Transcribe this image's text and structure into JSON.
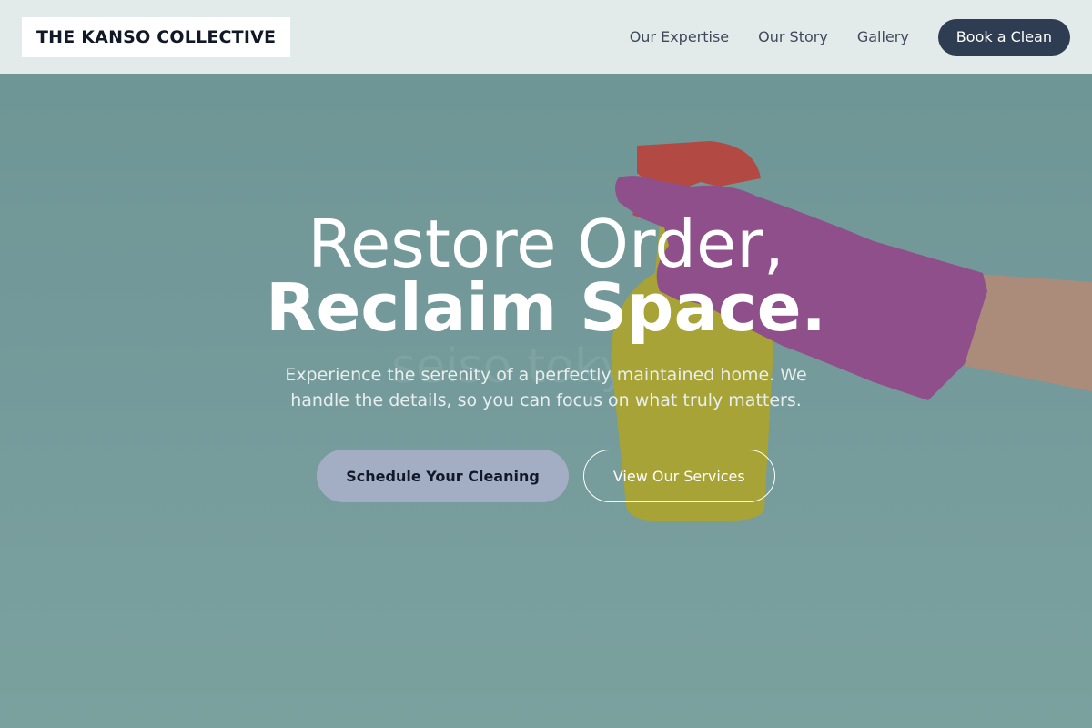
{
  "nav": {
    "logo": "THE KANSO COLLECTIVE",
    "links": [
      "Our Expertise",
      "Our Story",
      "Gallery"
    ],
    "cta": "Book a Clean"
  },
  "hero": {
    "title_line1": "Restore Order,",
    "title_line2": "Reclaim Space.",
    "subtitle": "Experience the serenity of a perfectly maintained home. We handle the details, so you can focus on what truly matters.",
    "primary_button": "Schedule Your Cleaning",
    "secondary_button": "View Our Services",
    "image_watermark": "seiso tokyo"
  },
  "colors": {
    "nav_bg": "#e3eaea",
    "cta_bg": "#2f3d52",
    "hero_bg": "#74999a",
    "primary_button_bg": "#a3aec4"
  }
}
